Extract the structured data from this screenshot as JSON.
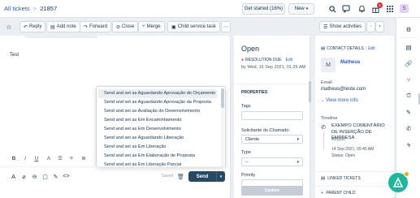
{
  "header": {
    "breadcrumb_link": "All tickets",
    "breadcrumb_sep": ">",
    "ticket_id": "21857",
    "get_started": "Get started (16%)",
    "new_button": "New",
    "notification_count": "5",
    "avatar_initial": "S"
  },
  "toolbar": {
    "reply": "Reply",
    "add_note": "Add note",
    "forward": "Forward",
    "close": "Close",
    "merge": "Merge",
    "child_service_task": "Child service task",
    "show_activities": "Show activities"
  },
  "editor": {
    "body_text": "Test",
    "dropdown_items": [
      "Send and set as Aguardando Aprovação do Orçamento",
      "Send and set as Aguardando Aprovação da Proposta",
      "Send and set as Avaliação do Desenvolvimento",
      "Send and set as Em Encaminhamento",
      "Send and set as Em Desenvolvimento",
      "Send and set as Aguardando Liberação",
      "Send and set as Em Liberação",
      "Send and set as Em Elaboração de Proposta",
      "Send and set as Em Liberação Parcial"
    ],
    "saved_label": "Saved",
    "send_label": "Send"
  },
  "properties": {
    "status": "Open",
    "resolution_due_label": "RESOLUTION DUE",
    "resolution_edit": "Edit",
    "resolution_due_value": "by Wed, 15 Sep 2021, 01:25 AM",
    "section_title": "PROPERTIES",
    "tags_label": "Tags",
    "solicitante_label": "Solicitante do Chamado:",
    "solicitante_value": "Cliente",
    "type_label": "Type",
    "type_value": "--",
    "priority_label": "Priority",
    "update_button": "Update"
  },
  "contact": {
    "section_title": "CONTACT DETAILS",
    "edit_link": "Edit",
    "avatar_initial": "M",
    "name": "Matheus",
    "email_label": "Email",
    "email": "matheus@teste.com",
    "view_more": "View more info",
    "timeline_label": "Timeline",
    "timeline_title": "EXEMPO COMENTÁRIO DE INSERÇÃO DE EMPRESA",
    "timeline_id": "#21857",
    "timeline_date": "14 Sep 2021, 09:45 AM",
    "timeline_status": "Status: Open",
    "linked_tickets": "LINKED TICKETS",
    "parent_child": "PARENT CHILD"
  },
  "colors": {
    "accent": "#2c5cc5",
    "send": "#264966",
    "danger": "#d72d30",
    "fab": "#20b69e"
  }
}
